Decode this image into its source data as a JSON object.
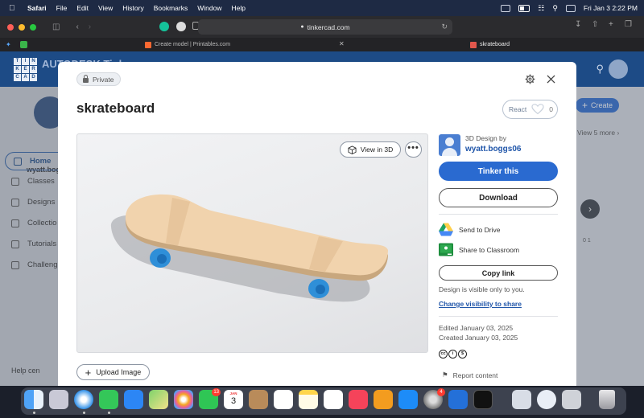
{
  "menubar": {
    "app_name": "Safari",
    "items": [
      "File",
      "Edit",
      "View",
      "History",
      "Bookmarks",
      "Window",
      "Help"
    ],
    "datetime": "Fri Jan 3  2:22 PM"
  },
  "browser": {
    "url": "tinkercad.com",
    "tabs": [
      {
        "title": "Create model | Printables.com"
      },
      {
        "title": "skrateboard"
      }
    ]
  },
  "background_page": {
    "brand": "AUTODESK Tink",
    "logo_letters": [
      "T",
      "I",
      "N",
      "K",
      "E",
      "R",
      "C",
      "A",
      "D"
    ],
    "username": "wyatt.bog",
    "nav": [
      {
        "label": "Home"
      },
      {
        "label": "Classes"
      },
      {
        "label": "Designs"
      },
      {
        "label": "Collectio"
      },
      {
        "label": "Tutorials"
      },
      {
        "label": "Challeng"
      }
    ],
    "help": "Help cen",
    "create_label": "Create",
    "view_more": "View 5 more",
    "card_stats": "0   1"
  },
  "modal": {
    "visibility_badge": "Private",
    "title": "skrateboard",
    "react_label": "React",
    "react_count": "0",
    "view3d_label": "View in 3D",
    "more_label": "•••",
    "upload_label": "Upload Image",
    "design_by": "3D Design by",
    "author": "wyatt.boggs06",
    "tinker_label": "Tinker this",
    "download_label": "Download",
    "send_drive": "Send to Drive",
    "share_classroom": "Share to Classroom",
    "copy_link": "Copy link",
    "visibility_text": "Design is visible only to you.",
    "visibility_link": "Change visibility to share",
    "edited": "Edited January 03, 2025",
    "created": "Created January 03, 2025",
    "license_marks": [
      "cc",
      "i",
      "$"
    ],
    "report": "Report content"
  },
  "dock": {
    "calendar_month": "JAN",
    "calendar_day": "3",
    "facetime_badge": "13",
    "app_badge": "4"
  },
  "colors": {
    "primary": "#2a6ad0",
    "link": "#1f55a9",
    "tinkercad_header": "#1d4b86",
    "board_deck": "#f1d3ad",
    "wheels": "#2f8fd8"
  }
}
